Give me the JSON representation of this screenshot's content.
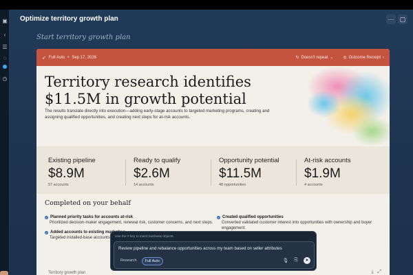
{
  "window": {
    "title": "Optimize territory growth plan",
    "plan_label": "Start territory growth plan"
  },
  "card": {
    "mode": "Full Auto",
    "date": "Sep 17, 2026",
    "repeat": "Doesn't repeat",
    "receipt": "Outcome Receipt",
    "headline": "Territory research identifies $11.5M in growth potential",
    "subtext": "The results translate directly into execution—adding early-stage accounts to targeted marketing programs, creating and assigning qualified opportunities, and creating next steps for at-risk accounts."
  },
  "stats": [
    {
      "label": "Existing pipeline",
      "value": "$8.9M",
      "sub": "57 accounts"
    },
    {
      "label": "Ready to qualify",
      "value": "$2.6M",
      "sub": "14 accounts"
    },
    {
      "label": "Opportunity potential",
      "value": "$11.5M",
      "sub": "48 opportunities"
    },
    {
      "label": "At-risk accounts",
      "value": "$1.9M",
      "sub": "4 accounts"
    }
  ],
  "completed": {
    "title": "Completed on your behalf",
    "tasks": [
      {
        "title": "Planned priority tasks for accounts at-risk",
        "desc": "Prioritized decision-maker engagement, renewal risk, customer concerns, and next steps."
      },
      {
        "title": "Created qualified opportunities",
        "desc": "Converted validated customer interest into opportunities with ownership and buyer engagement."
      },
      {
        "title": "Added accounts to existing marketing",
        "desc": "Targeted installed-base accounts read"
      }
    ]
  },
  "bottom_label": "Territory growth plan",
  "prompt": {
    "hint": "Use the # key to insert business objects.",
    "text": "Review pipeline and rebalance opportunities across my team based on seller attributes",
    "chips": [
      "Research",
      "Full Auto"
    ]
  },
  "colors": {
    "header": "#c4543f",
    "accent": "#2e6bb8",
    "background": "#1f3550"
  },
  "icons": [
    "sidebar-icon",
    "collapse-icon",
    "list-icon",
    "history-icon",
    "more-icon",
    "folder-icon",
    "rocket-icon",
    "repeat-icon",
    "receipt-icon",
    "mic-icon",
    "attach-icon",
    "send-icon",
    "check-icon"
  ]
}
